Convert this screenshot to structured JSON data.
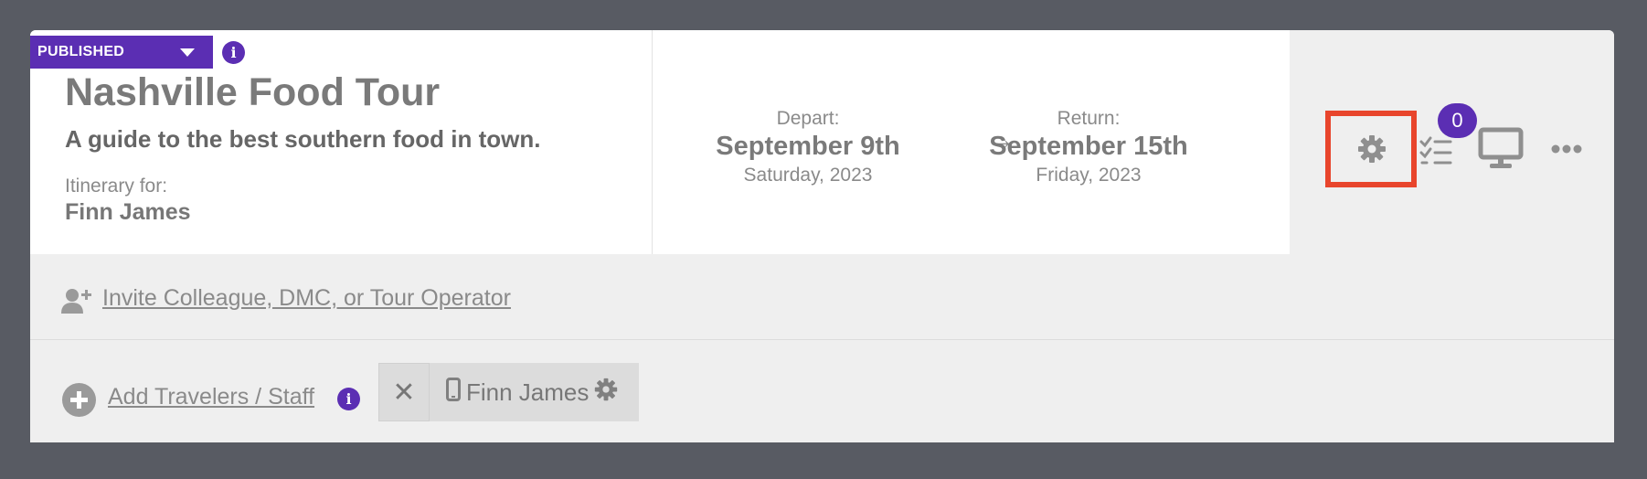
{
  "header": {
    "status_label": "PUBLISHED",
    "title": "Nashville Food Tour",
    "subtitle": "A guide to the best southern food in town.",
    "itinerary_label": "Itinerary for:",
    "itinerary_name": "Finn James"
  },
  "dates": {
    "depart_label": "Depart:",
    "depart_date": "September 9th",
    "depart_sub": "Saturday, 2023",
    "arrow": "→",
    "return_label": "Return:",
    "return_date": "September 15th",
    "return_sub": "Friday, 2023"
  },
  "toolbar": {
    "checklist_count": "0",
    "icons": [
      "gear-icon",
      "checklist-icon",
      "monitor-icon",
      "more-icon"
    ]
  },
  "invite": {
    "link_label": " Invite Colleague, DMC, or Tour Operator"
  },
  "travelers": {
    "add_label": "Add Travelers / Staff",
    "remove_symbol": "✕",
    "chip_name": "Finn James"
  },
  "colors": {
    "accent": "#5b2eb3",
    "highlight": "#e8452c",
    "background": "#585b63"
  }
}
